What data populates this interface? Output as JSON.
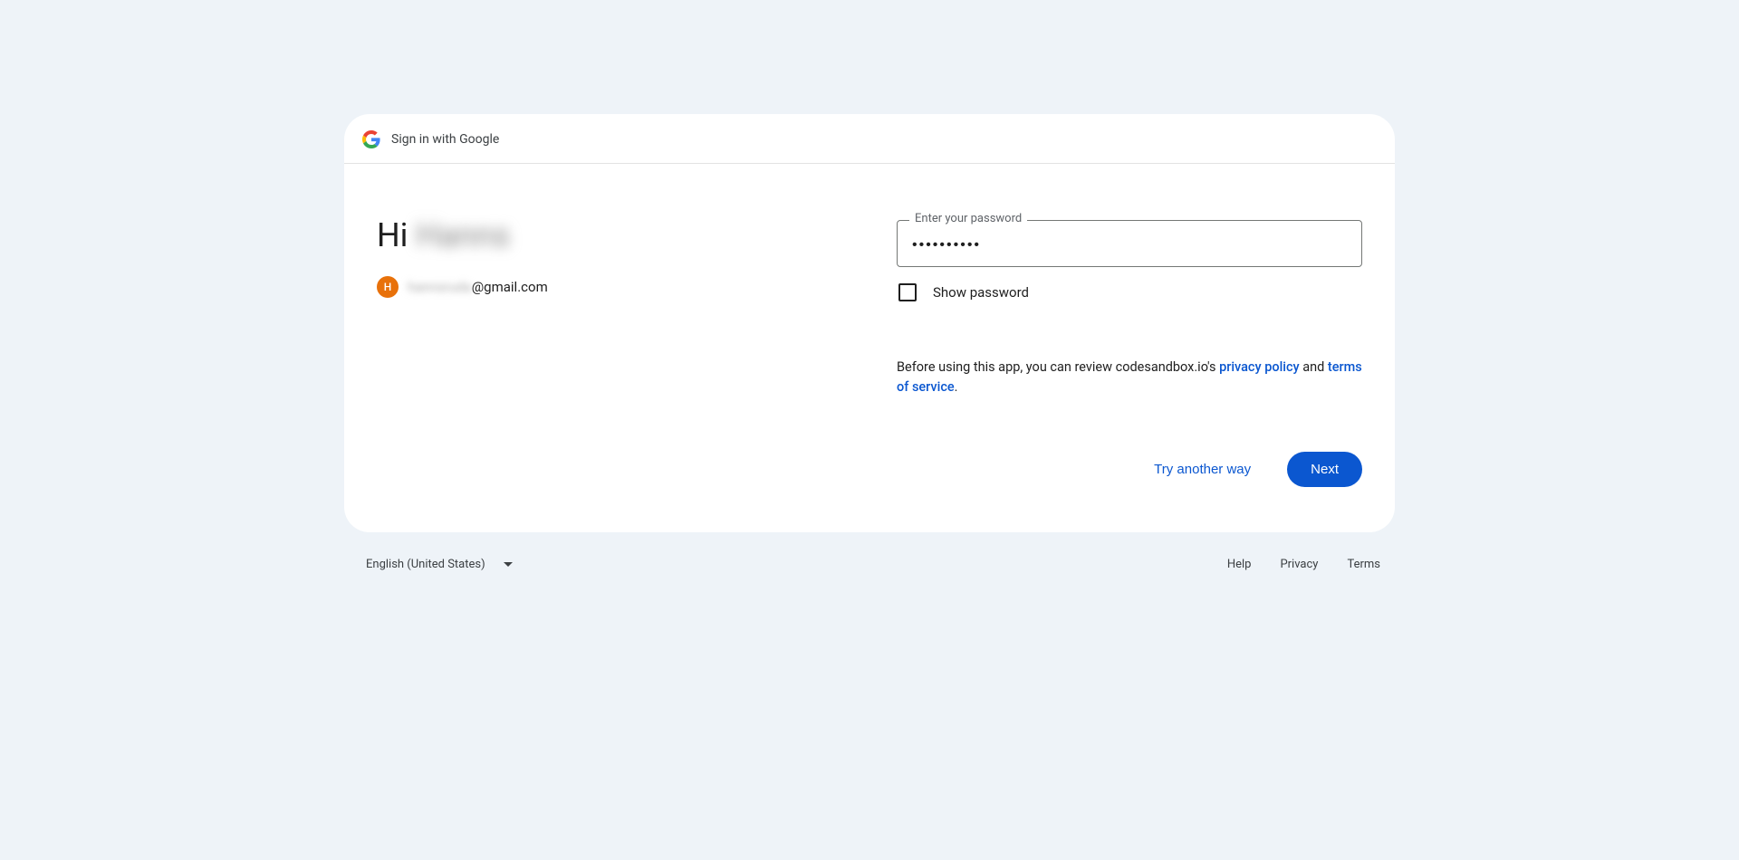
{
  "header": {
    "title": "Sign in with Google"
  },
  "greeting": {
    "prefix": "Hi ",
    "name": "Hanns"
  },
  "account": {
    "avatar_initial": "H",
    "email_local": "hannsruda",
    "email_domain": "@gmail.com"
  },
  "password_field": {
    "label": "Enter your password",
    "value": "••••••••••"
  },
  "show_password": {
    "label": "Show password"
  },
  "disclaimer": {
    "prefix": "Before using this app, you can review codesandbox.io's ",
    "privacy_link": "privacy policy",
    "middle": " and ",
    "terms_link": "terms of service",
    "suffix": "."
  },
  "actions": {
    "try_another": "Try another way",
    "next": "Next"
  },
  "footer": {
    "language": "English (United States)",
    "help": "Help",
    "privacy": "Privacy",
    "terms": "Terms"
  }
}
